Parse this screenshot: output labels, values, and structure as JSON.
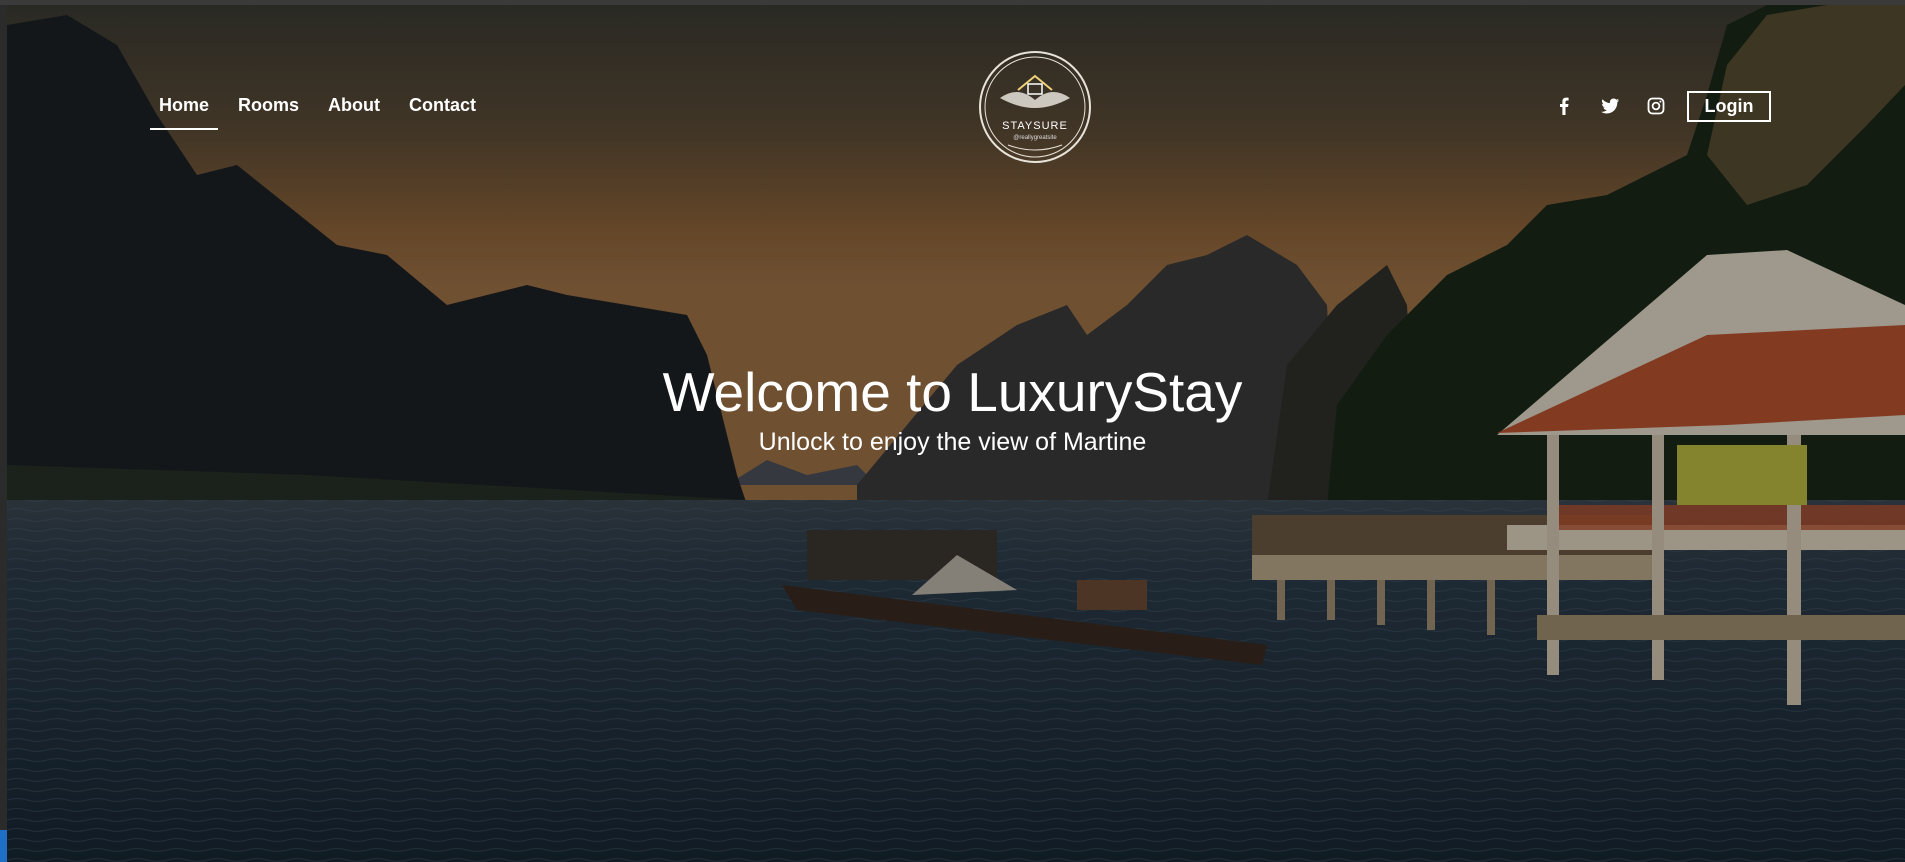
{
  "nav": {
    "items": [
      {
        "label": "Home",
        "active": true
      },
      {
        "label": "Rooms",
        "active": false
      },
      {
        "label": "About",
        "active": false
      },
      {
        "label": "Contact",
        "active": false
      }
    ]
  },
  "logo": {
    "name": "STAYSURE",
    "tagline": "@reallygreatsite"
  },
  "socials": [
    {
      "icon": "facebook-icon"
    },
    {
      "icon": "twitter-icon"
    },
    {
      "icon": "instagram-icon"
    }
  ],
  "header": {
    "login_label": "Login"
  },
  "hero": {
    "title": "Welcome to LuxuryStay",
    "subtitle": "Unlock to enjoy the view of Martine"
  },
  "colors": {
    "sky_top": "#3c3a30",
    "sky_horizon": "#9c6a3a",
    "water": "#24384a",
    "roof": "#b4512f",
    "text": "#ffffff"
  }
}
